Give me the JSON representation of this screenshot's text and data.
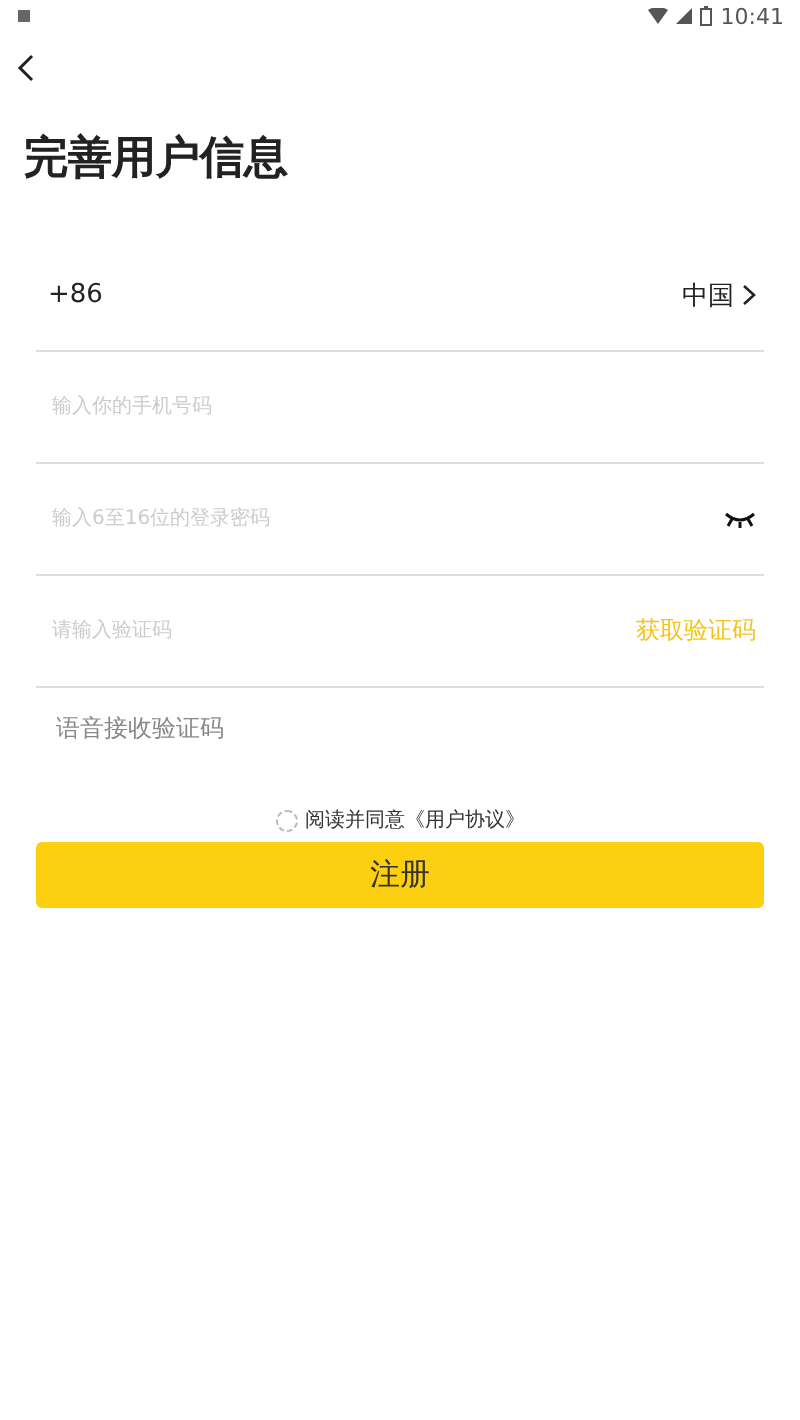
{
  "status_bar": {
    "time": "10:41"
  },
  "title": "完善用户信息",
  "country_row": {
    "code": "+86",
    "country": "中国"
  },
  "fields": [
    {
      "kind": "phone",
      "placeholder": "输入你的手机号码"
    },
    {
      "kind": "password",
      "placeholder": "输入6至16位的登录密码"
    },
    {
      "kind": "code",
      "placeholder": "请输入验证码",
      "action": "获取验证码"
    }
  ],
  "voice_link": "语音接收验证码",
  "agreement": {
    "checked": false,
    "text": "阅读并同意《用户协议》"
  },
  "submit": "注册"
}
